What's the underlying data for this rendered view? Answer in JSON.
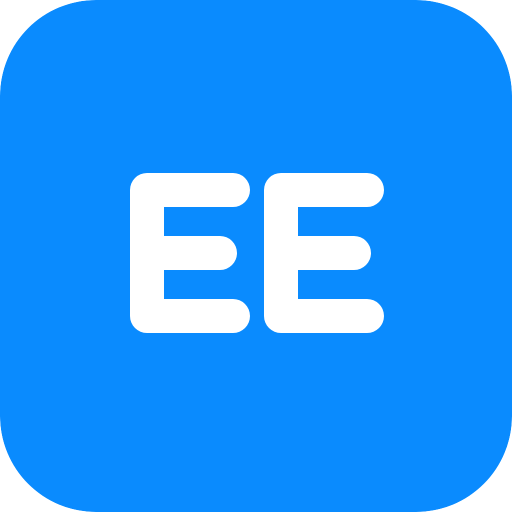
{
  "icon": {
    "name": "ee-icon",
    "text": "EE",
    "background_color": "#0A8BFE",
    "foreground_color": "#FFFFFF"
  }
}
